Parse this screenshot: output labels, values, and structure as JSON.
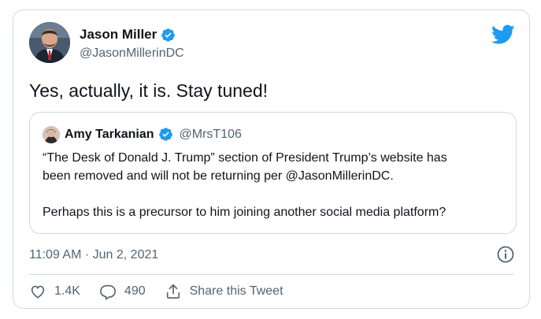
{
  "author": {
    "display_name": "Jason Miller",
    "handle": "@JasonMillerinDC",
    "avatar_icon": "avatar"
  },
  "tweet": {
    "text": "Yes, actually, it is. Stay tuned!"
  },
  "quoted": {
    "display_name": "Amy Tarkanian",
    "handle": "@MrsT106",
    "line1": "“The Desk of Donald J. Trump” section of President Trump’s website has",
    "line2": "been removed and will not be returning per @JasonMillerinDC.",
    "line3": "Perhaps this is a precursor to him joining another social media platform?"
  },
  "meta": {
    "timestamp": "11:09 AM · Jun 2, 2021"
  },
  "actions": {
    "likes": "1.4K",
    "replies": "490",
    "share_label": "Share this Tweet"
  },
  "colors": {
    "twitter_blue": "#1d9bf0",
    "secondary_text": "#536471",
    "border": "#cfd9de"
  }
}
